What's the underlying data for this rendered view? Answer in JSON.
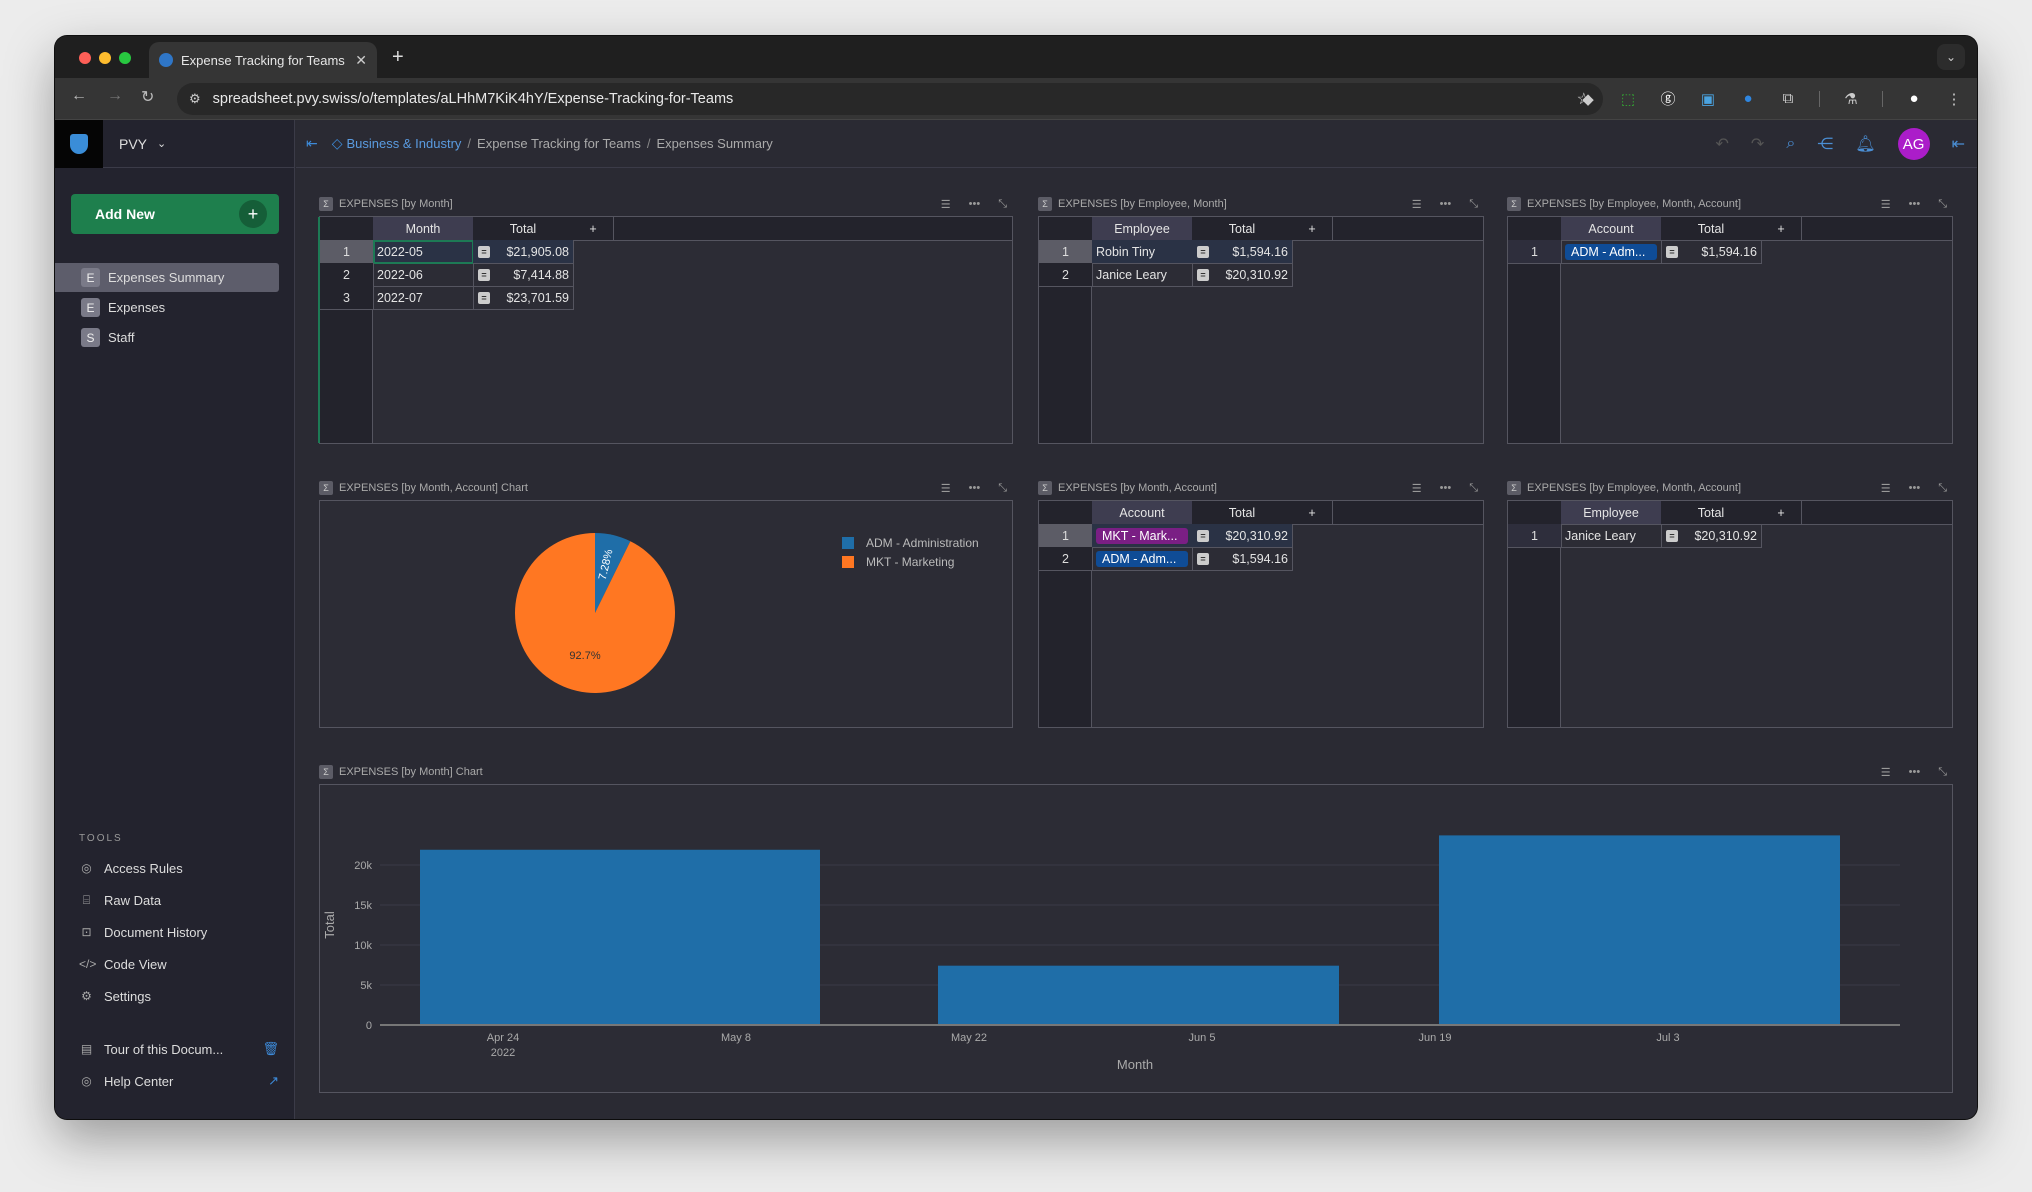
{
  "browser": {
    "tab_title": "Expense Tracking for Teams -",
    "new_tab": "+",
    "url": "spreadsheet.pvy.swiss/o/templates/aLHhM7KiK4hY/Expense-Tracking-for-Teams"
  },
  "sidebar": {
    "org": "PVY",
    "add_new": "Add New",
    "pages": [
      {
        "icon": "E",
        "label": "Expenses Summary",
        "active": true
      },
      {
        "icon": "E",
        "label": "Expenses"
      },
      {
        "icon": "S",
        "label": "Staff"
      }
    ],
    "tools_header": "TOOLS",
    "tools": [
      {
        "icon": "eye-icon",
        "label": "Access Rules"
      },
      {
        "icon": "database-icon",
        "label": "Raw Data"
      },
      {
        "icon": "history-icon",
        "label": "Document History"
      },
      {
        "icon": "code-icon",
        "label": "Code View"
      },
      {
        "icon": "gear-icon",
        "label": "Settings"
      }
    ],
    "bottom": [
      {
        "icon": "document-icon",
        "label": "Tour of this Docum...",
        "action": "trash-icon"
      },
      {
        "icon": "lifebuoy-icon",
        "label": "Help Center",
        "action": "external-link-icon"
      }
    ]
  },
  "header": {
    "breadcrumb": [
      "Business & Industry",
      "Expense Tracking for Teams",
      "Expenses Summary"
    ],
    "avatar": "AG",
    "avatar_color": "#ab1dc9"
  },
  "widgets": {
    "by_month": {
      "title": "EXPENSES [by Month]",
      "columns": [
        "Month",
        "Total",
        "+"
      ],
      "rows": [
        {
          "n": "1",
          "key": "2022-05",
          "total": "$21,905.08"
        },
        {
          "n": "2",
          "key": "2022-06",
          "total": "$7,414.88"
        },
        {
          "n": "3",
          "key": "2022-07",
          "total": "$23,701.59"
        }
      ]
    },
    "by_employee_month": {
      "title": "EXPENSES [by Employee, Month]",
      "columns": [
        "Employee",
        "Total",
        "+"
      ],
      "rows": [
        {
          "n": "1",
          "key": "Robin Tiny",
          "total": "$1,594.16"
        },
        {
          "n": "2",
          "key": "Janice Leary",
          "total": "$20,310.92"
        }
      ]
    },
    "by_emp_month_acct_1": {
      "title": "EXPENSES [by Employee, Month, Account]",
      "columns": [
        "Account",
        "Total",
        "+"
      ],
      "rows": [
        {
          "n": "1",
          "key": "ADM - Adm...",
          "chip": "#0f4c96",
          "total": "$1,594.16"
        }
      ]
    },
    "pie_chart": {
      "title": "EXPENSES [by Month, Account] Chart"
    },
    "by_month_account": {
      "title": "EXPENSES [by Month, Account]",
      "columns": [
        "Account",
        "Total",
        "+"
      ],
      "rows": [
        {
          "n": "1",
          "key": "MKT - Mark...",
          "chip": "#7a1f84",
          "total": "$20,310.92"
        },
        {
          "n": "2",
          "key": "ADM - Adm...",
          "chip": "#0f4c96",
          "total": "$1,594.16"
        }
      ]
    },
    "by_emp_month_acct_2": {
      "title": "EXPENSES [by Employee, Month, Account]",
      "columns": [
        "Employee",
        "Total",
        "+"
      ],
      "rows": [
        {
          "n": "1",
          "key": "Janice Leary",
          "total": "$20,310.92"
        }
      ]
    },
    "bar_chart": {
      "title": "EXPENSES [by Month] Chart"
    }
  },
  "chart_data": [
    {
      "type": "pie",
      "title": "EXPENSES [by Month, Account] Chart",
      "labels": [
        "ADM - Administration",
        "MKT - Marketing"
      ],
      "values": [
        7.28,
        92.7
      ],
      "value_labels": [
        "7.28%",
        "92.7%"
      ],
      "colors": [
        "#1f6ea8",
        "#ff7722"
      ],
      "legend": "top-right"
    },
    {
      "type": "bar",
      "title": "EXPENSES [by Month] Chart",
      "categories": [
        "2022-05",
        "2022-06",
        "2022-07"
      ],
      "values": [
        21905.08,
        7414.88,
        23701.59
      ],
      "xlabel": "Month",
      "ylabel": "Total",
      "ylim": [
        0,
        25000
      ],
      "yticks": [
        0,
        5000,
        10000,
        15000,
        20000
      ],
      "ytick_labels": [
        "0",
        "5k",
        "10k",
        "15k",
        "20k"
      ],
      "xtick_labels": [
        "Apr 24\n2022",
        "May 8",
        "May 22",
        "Jun 5",
        "Jun 19",
        "Jul 3"
      ],
      "color": "#1f6ea8",
      "grid": true
    }
  ]
}
